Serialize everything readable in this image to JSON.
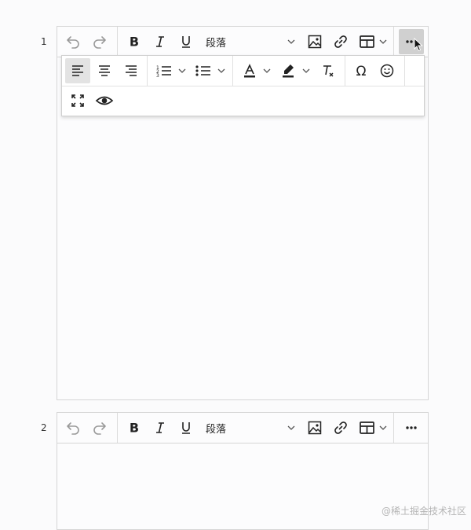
{
  "editors": [
    {
      "line_number": "1",
      "block_format": "段落"
    },
    {
      "line_number": "2",
      "block_format": "段落"
    }
  ],
  "toolbar_icons": {
    "undo": "undo-icon",
    "redo": "redo-icon",
    "bold": "bold-icon",
    "italic": "italic-icon",
    "underline": "underline-icon",
    "image": "image-icon",
    "link": "link-icon",
    "table": "table-icon",
    "more": "more-icon"
  },
  "more_popup": {
    "visible": true,
    "row1": [
      "align-left-icon",
      "align-center-icon",
      "align-right-icon",
      "numbered-list-icon",
      "bulleted-list-icon",
      "text-color-icon",
      "highlight-icon",
      "clear-format-icon",
      "special-char-icon",
      "emoji-icon"
    ],
    "row2": [
      "fullscreen-icon",
      "preview-icon"
    ],
    "active": "align-left-icon"
  },
  "colors": {
    "border": "#d6d6d6",
    "active_bg": "#e3e3e3",
    "more_active_bg": "#d0d0d0"
  },
  "watermark": "@稀土掘金技术社区"
}
